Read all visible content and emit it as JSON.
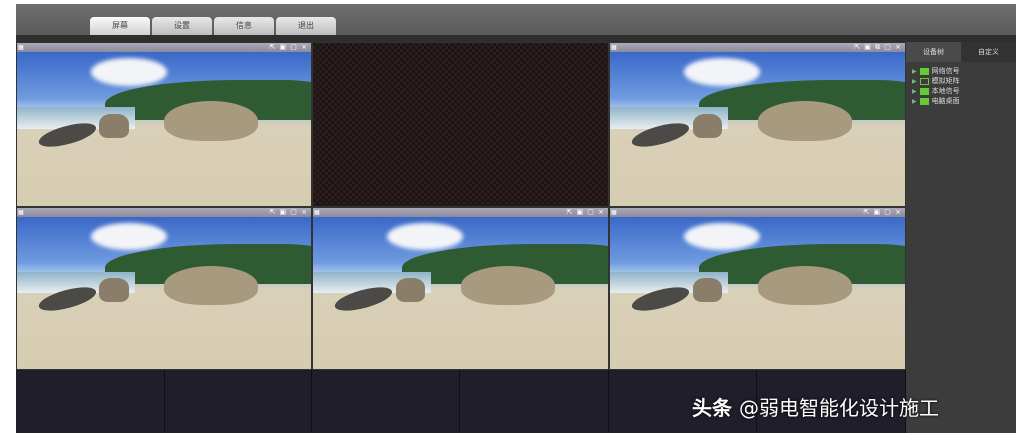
{
  "tabs": [
    {
      "label": "屏幕"
    },
    {
      "label": "设置"
    },
    {
      "label": "信息"
    },
    {
      "label": "退出"
    }
  ],
  "window_tools": {
    "full": "⇱ ▣ ⧉ ▢ ⨯",
    "short": "⇱ ▣ ▢ ⨯"
  },
  "sidebar": {
    "tabs": [
      {
        "label": "设备树"
      },
      {
        "label": "自定义"
      }
    ],
    "items": [
      {
        "label": "网络信号"
      },
      {
        "label": "模拟矩阵"
      },
      {
        "label": "本地信号"
      },
      {
        "label": "电脑桌面"
      }
    ]
  },
  "watermark": {
    "brand": "头条",
    "handle": "@弱电智能化设计施工"
  }
}
